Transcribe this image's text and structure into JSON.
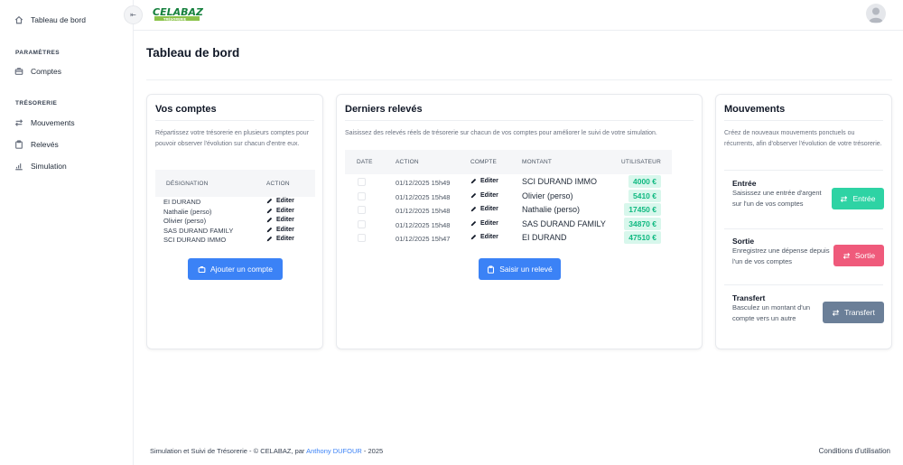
{
  "sidebar": {
    "dashboard": "Tableau de bord",
    "section_params": "PARAMÈTRES",
    "accounts": "Comptes",
    "section_treasury": "TRÉSORERIE",
    "movements": "Mouvements",
    "statements": "Relevés",
    "simulation": "Simulation"
  },
  "topbar": {
    "logo_text": "CELABAZ",
    "logo_sub": "TRÉSORERIE"
  },
  "page": {
    "title": "Tableau de bord"
  },
  "accounts_card": {
    "title": "Vos comptes",
    "description": "Répartissez votre trésorerie en plusieurs comptes pour pouvoir observer l'évolution sur chacun d'entre eux.",
    "col_designation": "DÉSIGNATION",
    "col_action": "ACTION",
    "edit_label": "Editer",
    "rows": [
      "EI DURAND",
      "Nathalie (perso)",
      "Olivier (perso)",
      "SAS DURAND FAMILY",
      "SCI DURAND IMMO"
    ],
    "add_button": "Ajouter un compte"
  },
  "statements_card": {
    "title": "Derniers relevés",
    "description": "Saisissez des relevés réels de trésorerie sur chacun de vos comptes pour améliorer le suivi de votre simulation.",
    "col_date": "DATE",
    "col_action": "ACTION",
    "col_account": "COMPTE",
    "col_amount": "MONTANT",
    "col_user": "UTILISATEUR",
    "edit_label": "Editer",
    "rows": [
      {
        "date": "01/12/2025 15h49",
        "account": "SCI DURAND IMMO",
        "amount": "4000 €"
      },
      {
        "date": "01/12/2025 15h48",
        "account": "Olivier (perso)",
        "amount": "5410 €"
      },
      {
        "date": "01/12/2025 15h48",
        "account": "Nathalie (perso)",
        "amount": "17450 €"
      },
      {
        "date": "01/12/2025 15h48",
        "account": "SAS DURAND FAMILY",
        "amount": "34870 €"
      },
      {
        "date": "01/12/2025 15h47",
        "account": "EI DURAND",
        "amount": "47510 €"
      }
    ],
    "add_button": "Saisir un relevé"
  },
  "movements_card": {
    "title": "Mouvements",
    "description": "Créez de nouveaux mouvements ponctuels ou récurrents, afin d'observer l'évolution de votre trésorerie.",
    "income_title": "Entrée",
    "income_desc": "Saisissez une entrée d'argent sur l'un de vos comptes",
    "income_button": "Entrée",
    "expense_title": "Sortie",
    "expense_desc": "Enregistrez une dépense depuis l'un de vos comptes",
    "expense_button": "Sortie",
    "transfer_title": "Transfert",
    "transfer_desc": "Basculez un montant d'un compte vers un autre",
    "transfer_button": "Transfert"
  },
  "footer": {
    "text": "Simulation et Suivi de Trésorerie - © CELABAZ, par",
    "author": "Anthony DUFOUR",
    "year": "- 2025",
    "terms": "Conditions d'utilisation"
  },
  "colors": {
    "primary": "#3b82f6",
    "success": "#2ed3a4",
    "danger": "#ef5a7b",
    "neutral": "#6b7f98"
  }
}
